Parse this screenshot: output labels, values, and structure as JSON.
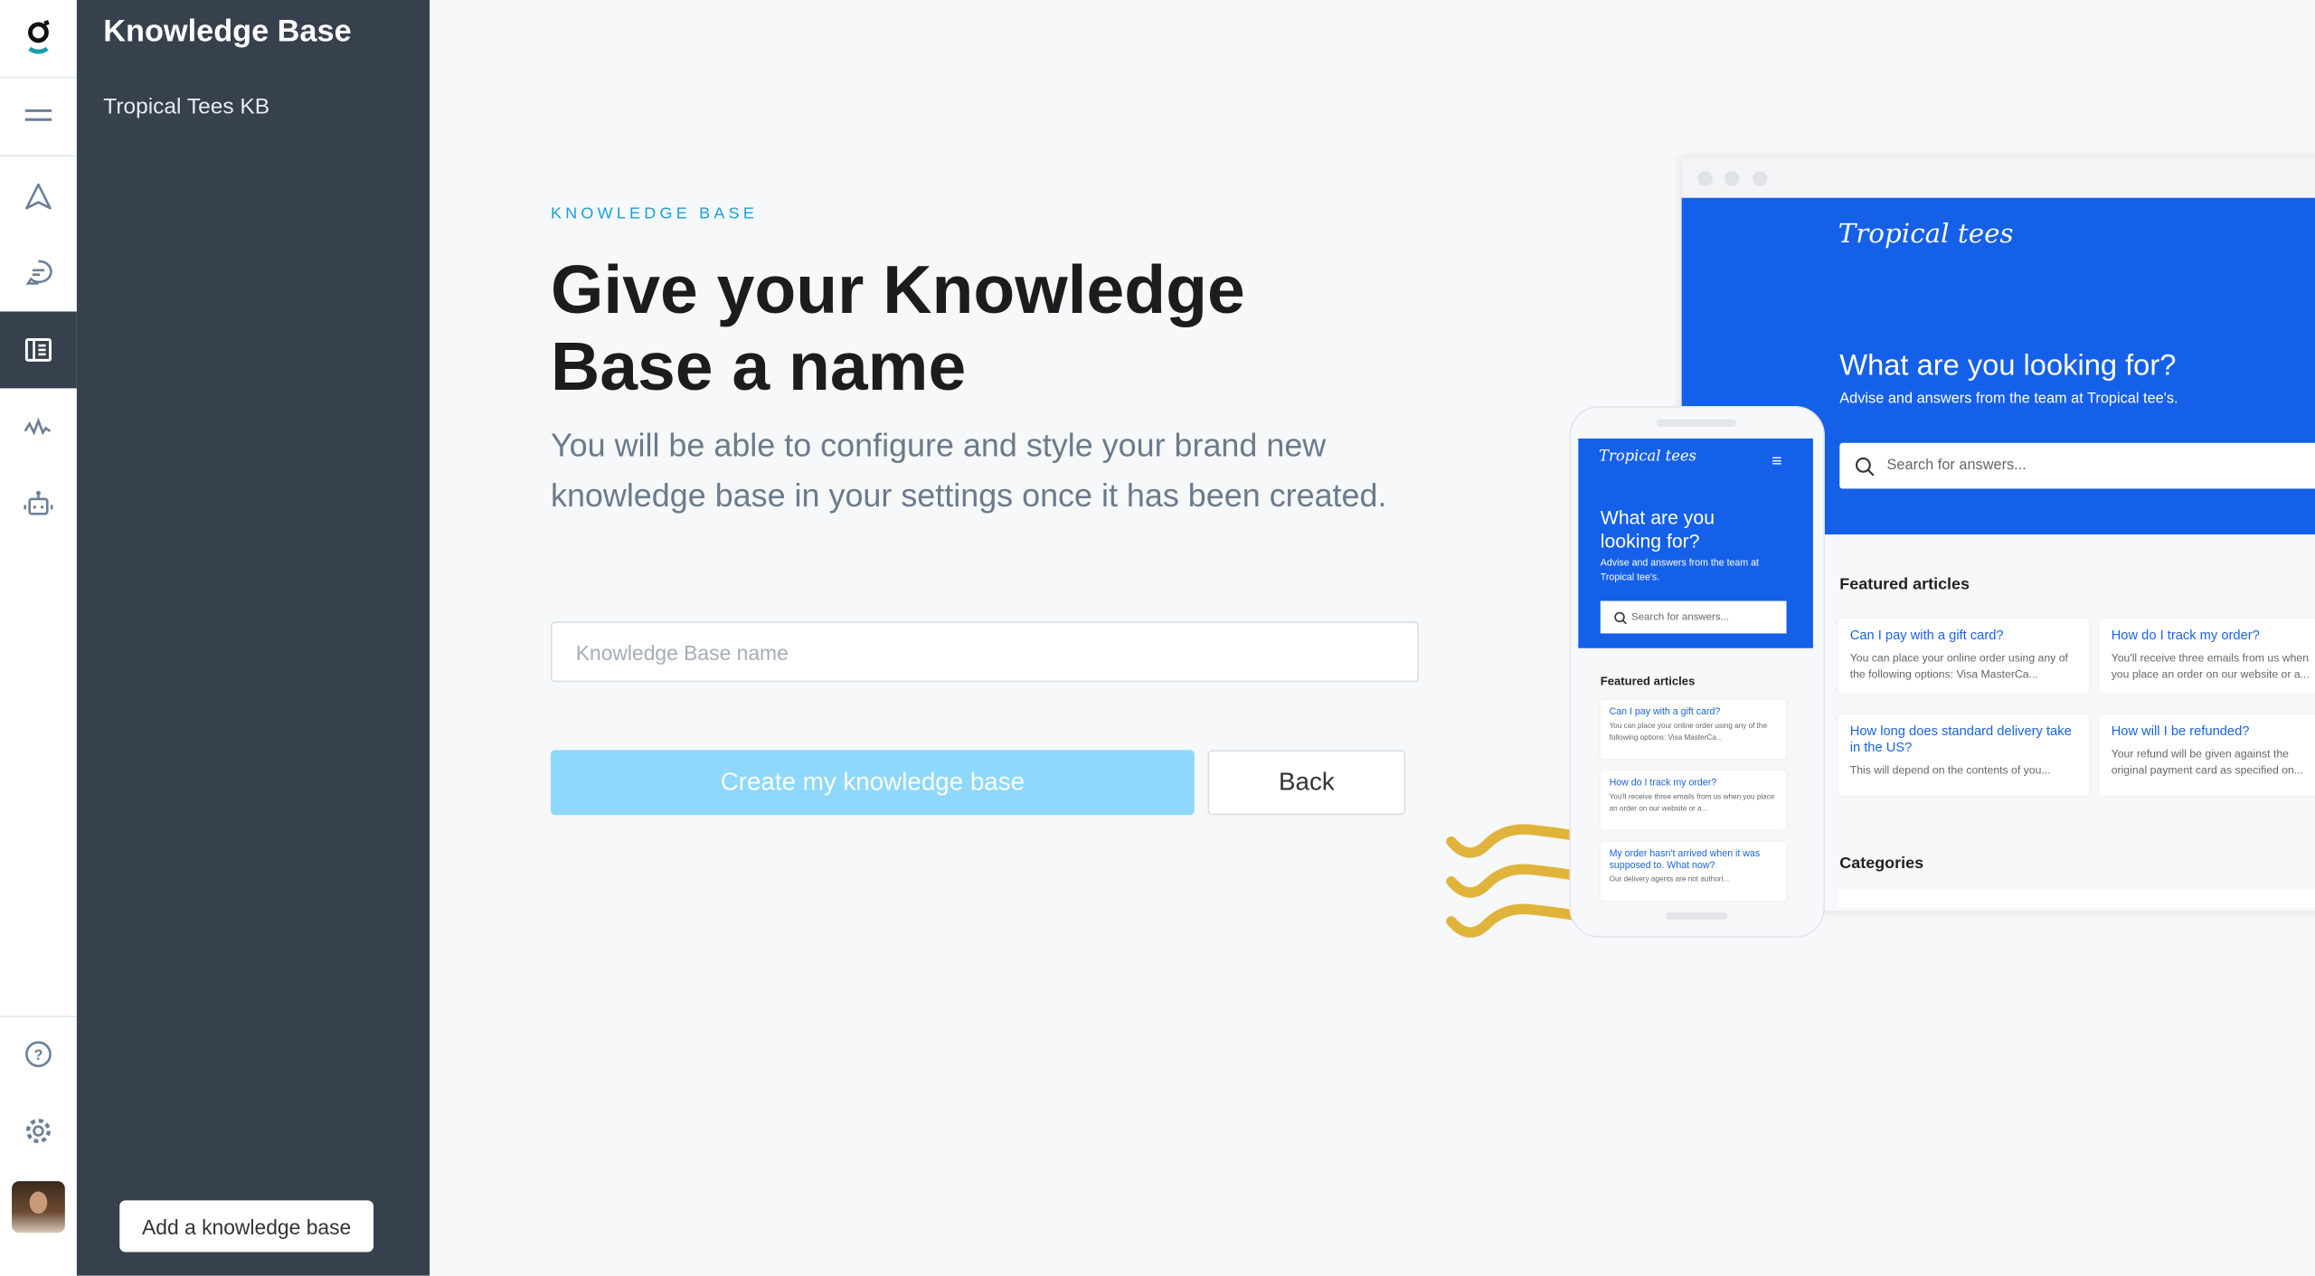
{
  "rail": {
    "items": [
      {
        "icon": "logo-icon"
      },
      {
        "icon": "menu-icon"
      },
      {
        "icon": "navigation-icon"
      },
      {
        "icon": "chat-icon"
      },
      {
        "icon": "knowledge-base-icon",
        "active": true
      },
      {
        "icon": "activity-icon"
      },
      {
        "icon": "bot-icon"
      },
      {
        "icon": "help-icon"
      },
      {
        "icon": "settings-icon"
      },
      {
        "icon": "avatar"
      }
    ]
  },
  "sidebar": {
    "title": "Knowledge Base",
    "items": [
      "Tropical Tees KB"
    ],
    "add_button": "Add a knowledge base"
  },
  "main": {
    "eyebrow": "KNOWLEDGE BASE",
    "title": "Give your Knowledge Base a name",
    "description": "You will be able to configure and style your brand new knowledge base in your settings once it has been created.",
    "name_input": {
      "value": "",
      "placeholder": "Knowledge Base name"
    },
    "create_button": "Create my knowledge base",
    "back_button": "Back"
  },
  "preview": {
    "brand": "Tropical tees",
    "heading": "What are you looking for?",
    "subheading": "Advise and answers from the team at Tropical tee's.",
    "search_placeholder": "Search for answers...",
    "featured_title": "Featured articles",
    "categories_title": "Categories",
    "articles": [
      {
        "title": "Can I pay with a gift card?",
        "body": "You can place your online order using any of the following options: Visa MasterCa..."
      },
      {
        "title": "How do I track my order?",
        "body": "You'll receive three emails from us when you place an order on our website or a..."
      },
      {
        "title": "How long does standard delivery take in the US?",
        "body": "This will depend on the contents of you..."
      },
      {
        "title": "How will I be refunded?",
        "body": "Your refund will be given against the original payment card as specified on..."
      }
    ],
    "mobile_articles": [
      {
        "title": "Can I pay with a gift card?",
        "body": "You can place your online order using any of the following options: Visa MasterCa..."
      },
      {
        "title": "How do I track my order?",
        "body": "You'll receive three emails from us when you place an order on our website or a..."
      },
      {
        "title": "My order hasn't arrived when it was supposed to. What now?",
        "body": "Our delivery agents are not authori..."
      }
    ]
  },
  "colors": {
    "sidebar": "#37404d",
    "accent": "#1a9ee0",
    "create_button": "#8dd8fb",
    "preview_blue": "#1560e8",
    "squiggle": "#e0b43a"
  }
}
